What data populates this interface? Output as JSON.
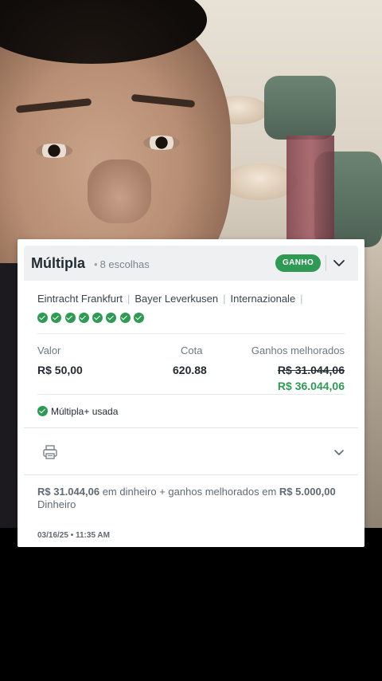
{
  "bet": {
    "title": "Múltipla",
    "dot": "•",
    "selections": "8 escolhas",
    "status": "GANHO",
    "teams": [
      "Eintracht Frankfurt",
      "Bayer Leverkusen",
      "Internazionale"
    ],
    "team_separator": "|",
    "result_icons": [
      "check-icon",
      "check-icon",
      "check-icon",
      "check-icon",
      "check-icon",
      "check-icon",
      "check-icon",
      "check-icon"
    ],
    "stake_label": "Valor",
    "stake_value": "R$ 50,00",
    "odds_label": "Cota",
    "odds_value": "620.88",
    "winnings_label": "Ganhos melhorados",
    "old_winnings": "R$ 31.044,06",
    "new_winnings": "R$ 36.044,06",
    "boost_label": "Múltipla+ usada",
    "cash_amount": "R$ 31.044,06",
    "cash_text_1": " em dinheiro + ganhos melhorados em ",
    "bonus_amount": "R$ 5.000,00",
    "cash_text_2": " Dinheiro",
    "date": "03/16/25 • 11:35 AM"
  },
  "colors": {
    "success": "#2e9a54",
    "text": "#242c33",
    "muted": "#6e7880",
    "header_bg": "#eef0f2"
  },
  "icons": {
    "collapse": "chevron-down-icon",
    "print": "printer-icon",
    "expand": "chevron-down-icon"
  }
}
